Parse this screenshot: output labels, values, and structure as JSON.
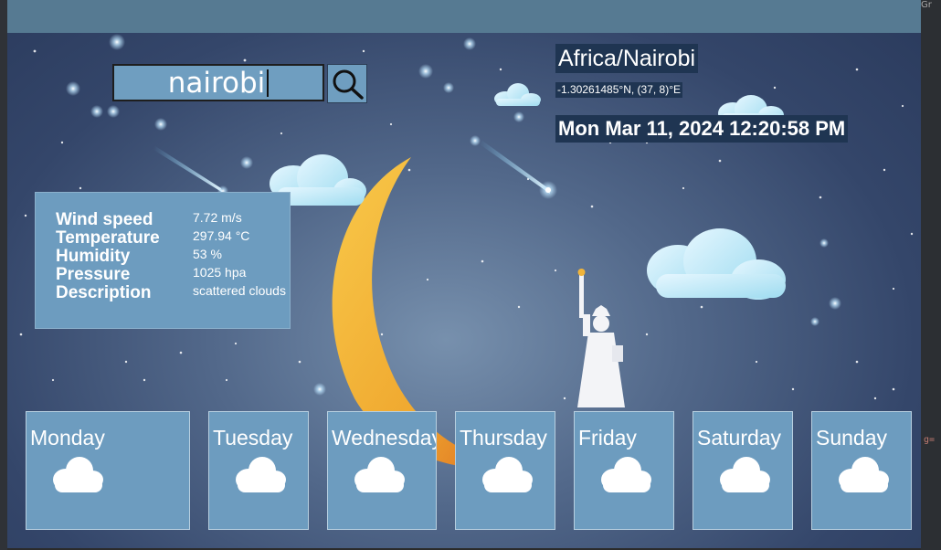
{
  "search": {
    "value": "nairobi"
  },
  "location": {
    "timezone": "Africa/Nairobi",
    "coordinates": "-1.30261485°N, (37, 8)°E",
    "datetime": "Mon Mar 11, 2024 12:20:58 PM"
  },
  "weather": {
    "labels": {
      "wind": "Wind speed",
      "temperature": "Temperature",
      "humidity": "Humidity",
      "pressure": "Pressure",
      "description": "Description"
    },
    "values": {
      "wind": "7.72 m/s",
      "temperature": "297.94 °C",
      "humidity": "53 %",
      "pressure": "1025 hpa",
      "description": "scattered clouds"
    }
  },
  "forecast": {
    "days": [
      {
        "name": "Monday",
        "icon": "cloud-icon"
      },
      {
        "name": "Tuesday",
        "icon": "cloud-icon"
      },
      {
        "name": "Wednesday",
        "icon": "cloud-icon"
      },
      {
        "name": "Thursday",
        "icon": "cloud-icon"
      },
      {
        "name": "Friday",
        "icon": "cloud-icon"
      },
      {
        "name": "Saturday",
        "icon": "cloud-icon"
      },
      {
        "name": "Sunday",
        "icon": "cloud-icon"
      }
    ]
  },
  "edge_text": {
    "right_top": "Gr",
    "right_mid": "g="
  },
  "colors": {
    "titlebar": "#567a92",
    "panel": "#6d9cbf",
    "label_background": "#1f3552",
    "moon": "#f0b43a"
  }
}
